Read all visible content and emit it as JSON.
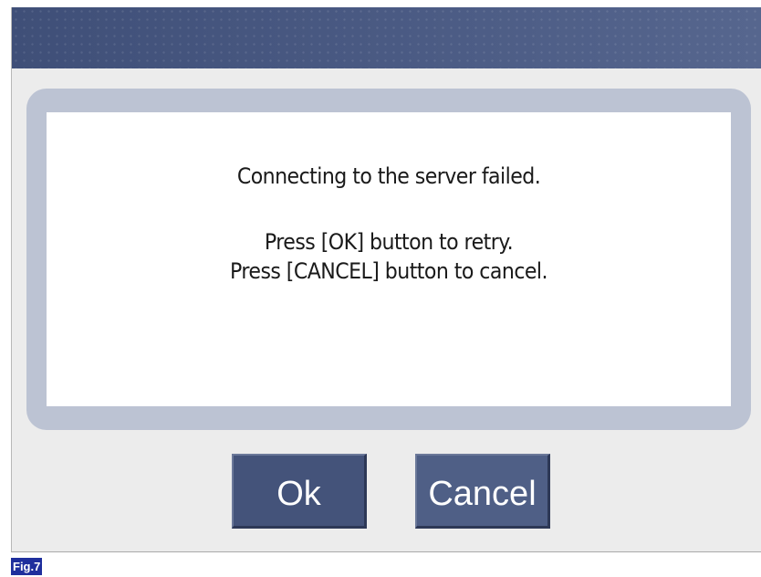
{
  "dialog": {
    "message": {
      "line1": "Connecting to the server failed.",
      "line2": "Press [OK] button to retry.",
      "line3": "Press [CANCEL] button to cancel."
    },
    "buttons": {
      "ok_label": "Ok",
      "cancel_label": "Cancel"
    }
  },
  "figure": {
    "label": "Fig.7"
  },
  "colors": {
    "title_bar": "#46557b",
    "button_bg": "#46557b",
    "frame_border": "#bcc3d3",
    "background": "#ececec",
    "figure_label_bg": "#1f2f9d"
  }
}
